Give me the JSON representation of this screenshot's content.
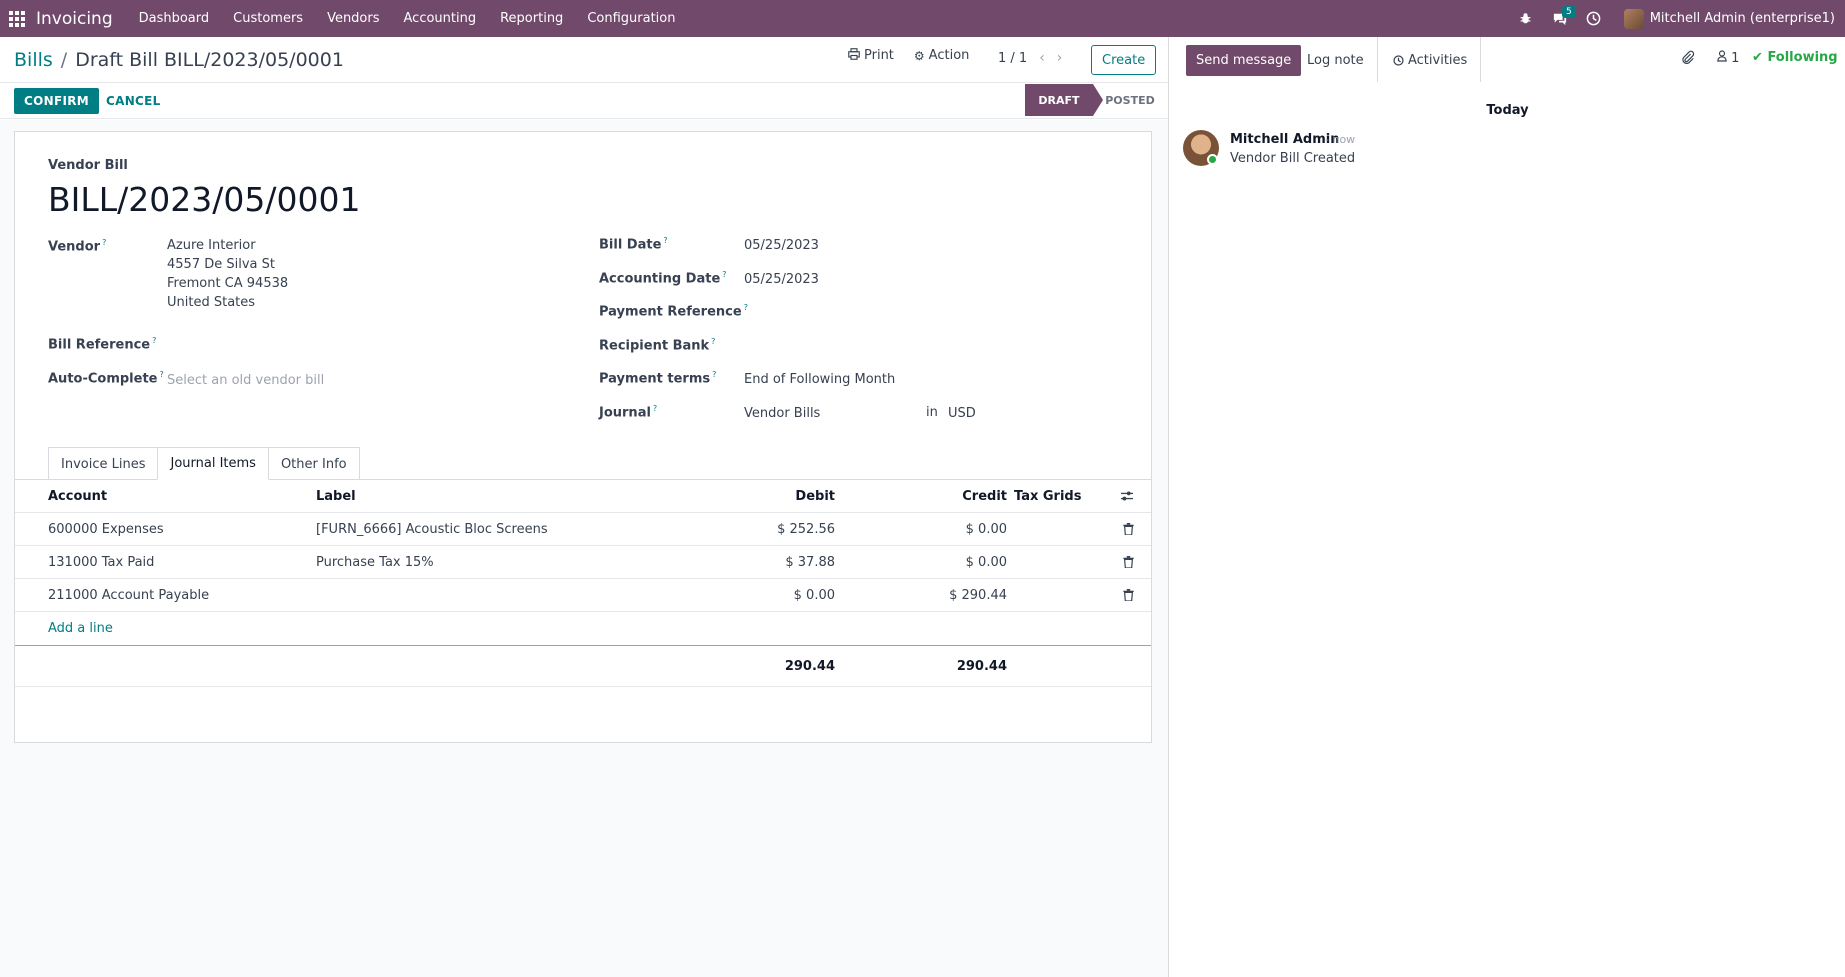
{
  "app": {
    "name": "Invoicing",
    "menu": [
      "Dashboard",
      "Customers",
      "Vendors",
      "Accounting",
      "Reporting",
      "Configuration"
    ],
    "messages_badge": "5",
    "user": "Mitchell Admin (enterprise1)"
  },
  "breadcrumb": {
    "parent": "Bills",
    "separator": "/",
    "current": "Draft Bill BILL/2023/05/0001"
  },
  "toolbar": {
    "print": "Print",
    "action": "Action",
    "pager": "1 / 1",
    "create": "Create"
  },
  "statusbar": {
    "confirm": "CONFIRM",
    "cancel": "CANCEL",
    "stages": [
      "DRAFT",
      "POSTED"
    ]
  },
  "form": {
    "doc_type": "Vendor Bill",
    "title": "BILL/2023/05/0001",
    "left": {
      "vendor_label": "Vendor",
      "vendor_name": "Azure Interior",
      "vendor_street": "4557 De Silva St",
      "vendor_city": "Fremont CA 94538",
      "vendor_country": "United States",
      "bill_reference_label": "Bill Reference",
      "auto_complete_label": "Auto-Complete",
      "auto_complete_placeholder": "Select an old vendor bill"
    },
    "right": {
      "bill_date_label": "Bill Date",
      "bill_date": "05/25/2023",
      "accounting_date_label": "Accounting Date",
      "accounting_date": "05/25/2023",
      "payment_reference_label": "Payment Reference",
      "recipient_bank_label": "Recipient Bank",
      "payment_terms_label": "Payment terms",
      "payment_terms": "End of Following Month",
      "journal_label": "Journal",
      "journal": "Vendor Bills",
      "journal_in": "in",
      "currency": "USD"
    },
    "help_mark": "?"
  },
  "tabs": [
    "Invoice Lines",
    "Journal Items",
    "Other Info"
  ],
  "journal_items": {
    "columns": [
      "Account",
      "Label",
      "Debit",
      "Credit",
      "Tax Grids"
    ],
    "rows": [
      {
        "account": "600000 Expenses",
        "label": "[FURN_6666] Acoustic Bloc Screens",
        "debit": "$ 252.56",
        "credit": "$ 0.00"
      },
      {
        "account": "131000 Tax Paid",
        "label": "Purchase Tax 15%",
        "debit": "$ 37.88",
        "credit": "$ 0.00"
      },
      {
        "account": "211000 Account Payable",
        "label": "",
        "debit": "$ 0.00",
        "credit": "$ 290.44"
      }
    ],
    "add_line": "Add a line",
    "total_debit": "290.44",
    "total_credit": "290.44"
  },
  "chatter": {
    "send_message": "Send message",
    "log_note": "Log note",
    "activities": "Activities",
    "followers_count": "1",
    "following": "Following",
    "day_label": "Today",
    "message": {
      "author": "Mitchell Admin",
      "time": "- now",
      "body": "Vendor Bill Created"
    }
  }
}
